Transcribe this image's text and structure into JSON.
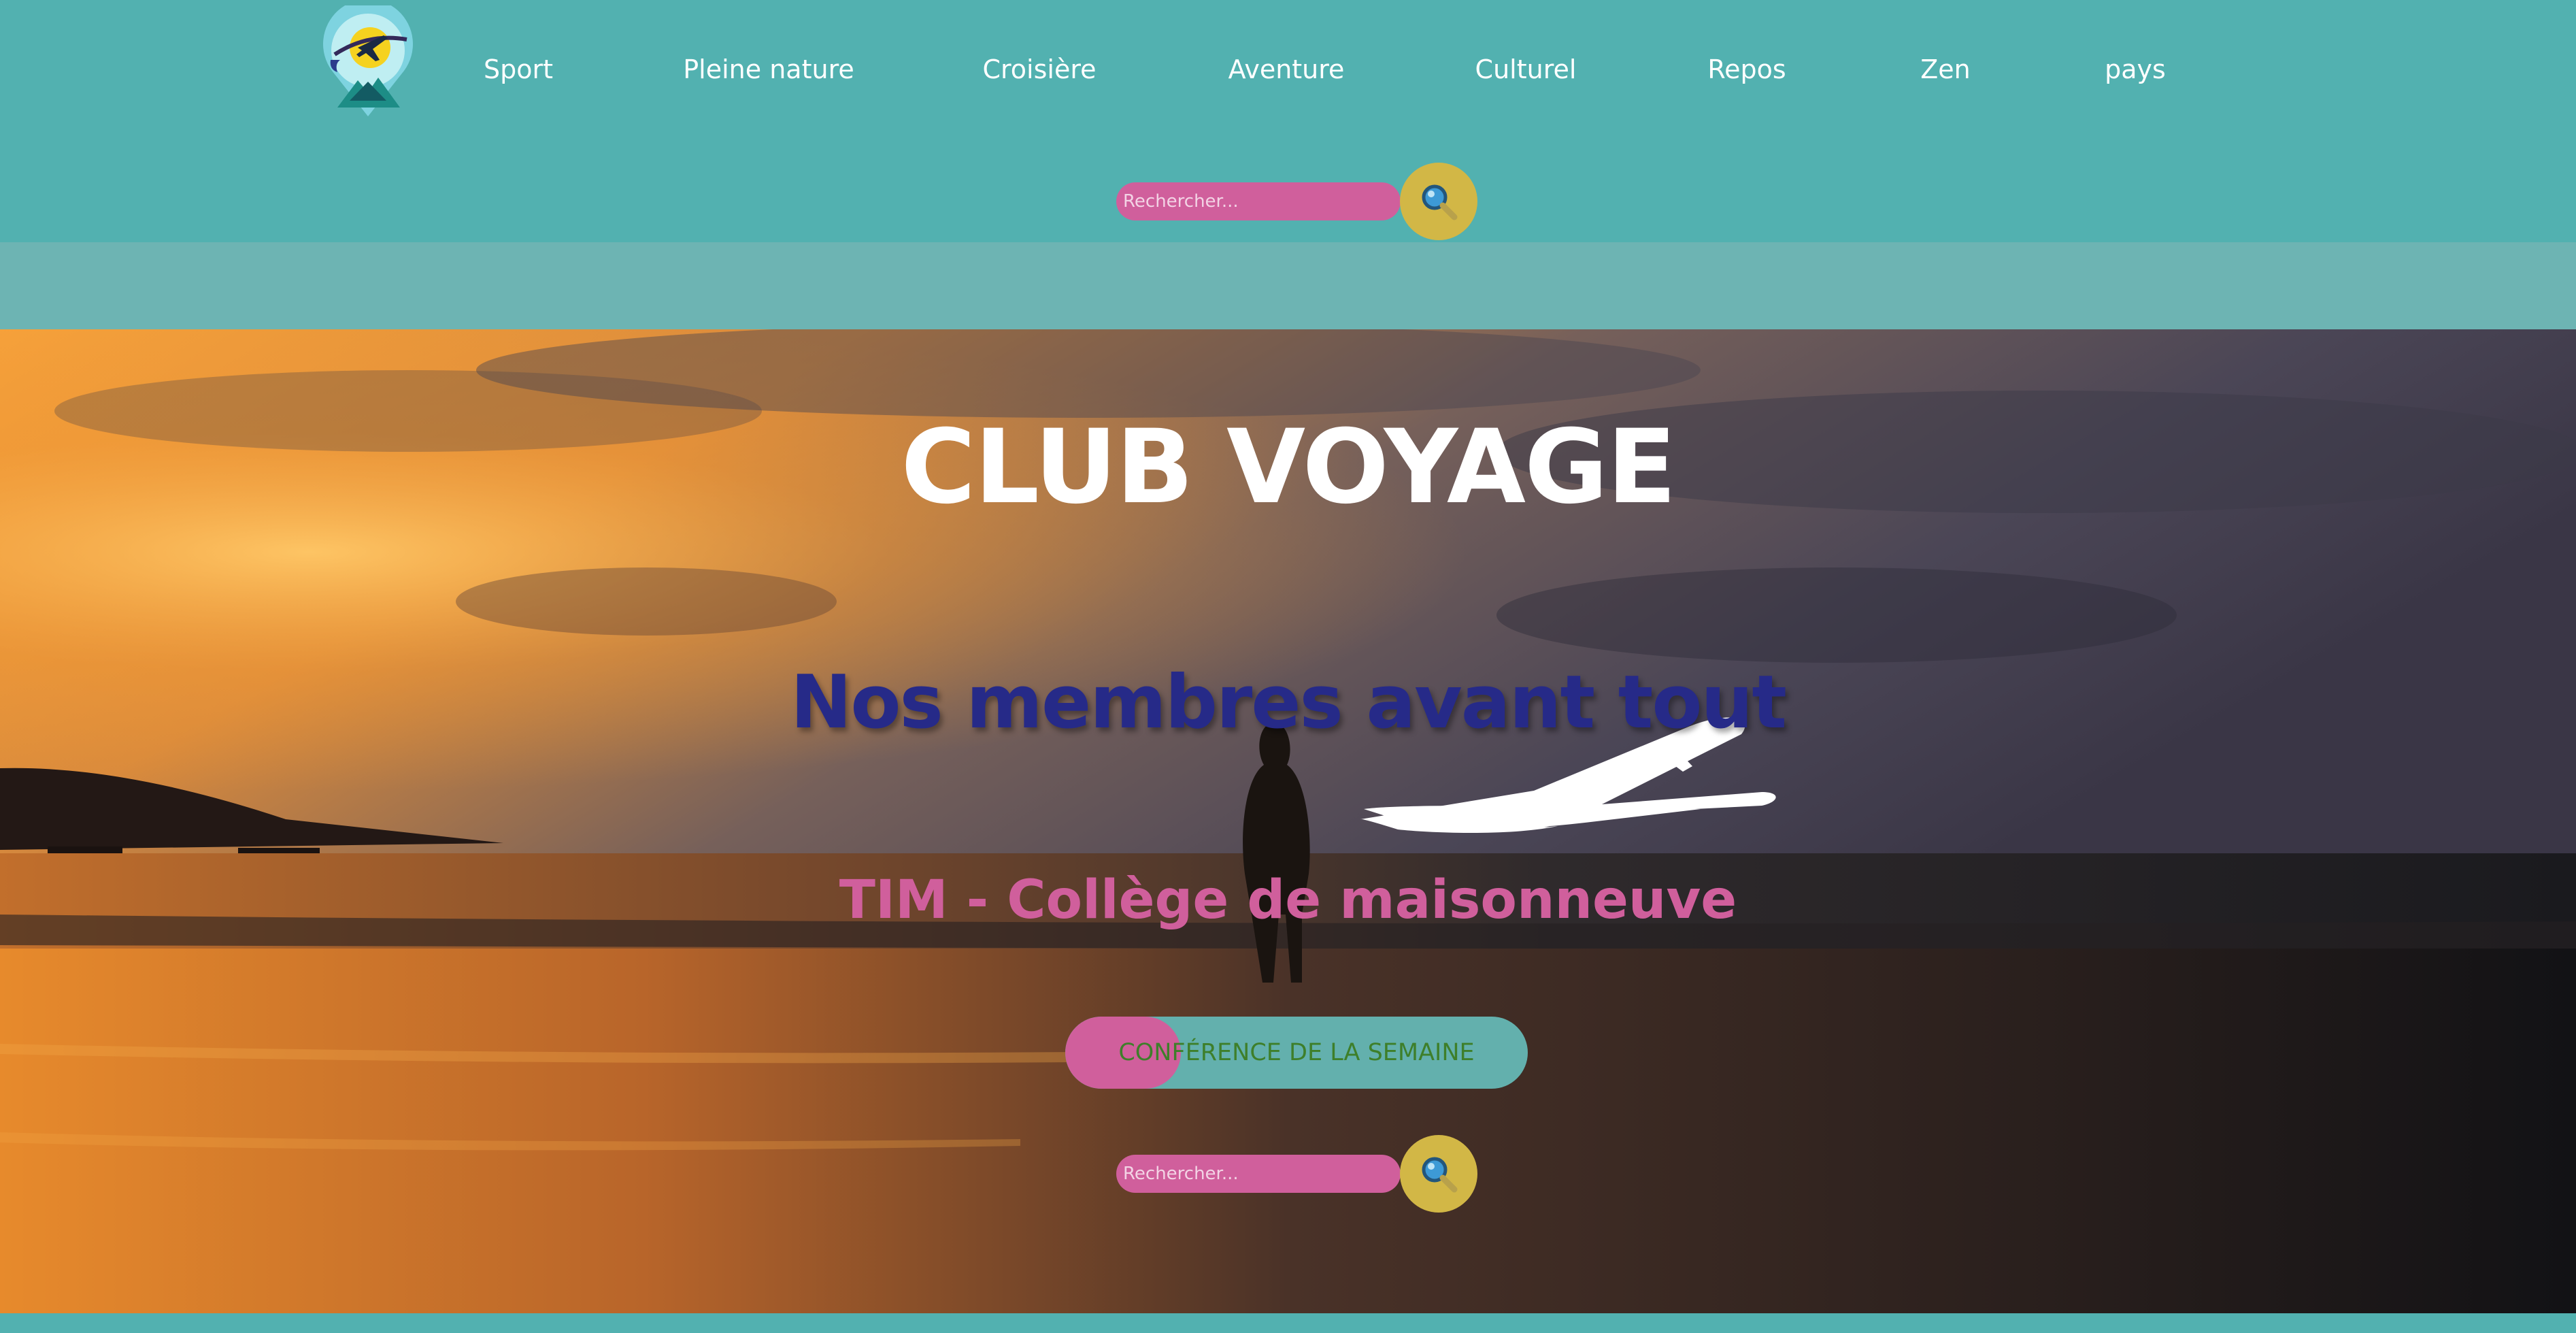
{
  "nav": {
    "logo_icon": "travel-pin-plane-logo",
    "items": [
      {
        "label": "Sport"
      },
      {
        "label": "Pleine nature"
      },
      {
        "label": "Croisière"
      },
      {
        "label": "Aventure"
      },
      {
        "label": "Culturel"
      },
      {
        "label": "Repos"
      },
      {
        "label": "Zen"
      },
      {
        "label": "pays"
      }
    ]
  },
  "search_top": {
    "placeholder": "Rechercher...",
    "button_icon": "magnifier-icon"
  },
  "hero": {
    "title": "CLUB VOYAGE",
    "slogan": "Nos membres avant tout",
    "college": "TIM - Collège de maisonneuve",
    "cta_label": "CONFÉRENCE DE LA SEMAINE"
  },
  "search_hero": {
    "placeholder": "Rechercher...",
    "button_icon": "magnifier-icon"
  },
  "colors": {
    "primary_teal": "#52b1b0",
    "band_teal": "#6db4b3",
    "search_pink": "#d05f9c",
    "search_gold": "#d2b746",
    "slogan_navy": "#262a88",
    "cta_text_green": "#3e7f2a"
  }
}
